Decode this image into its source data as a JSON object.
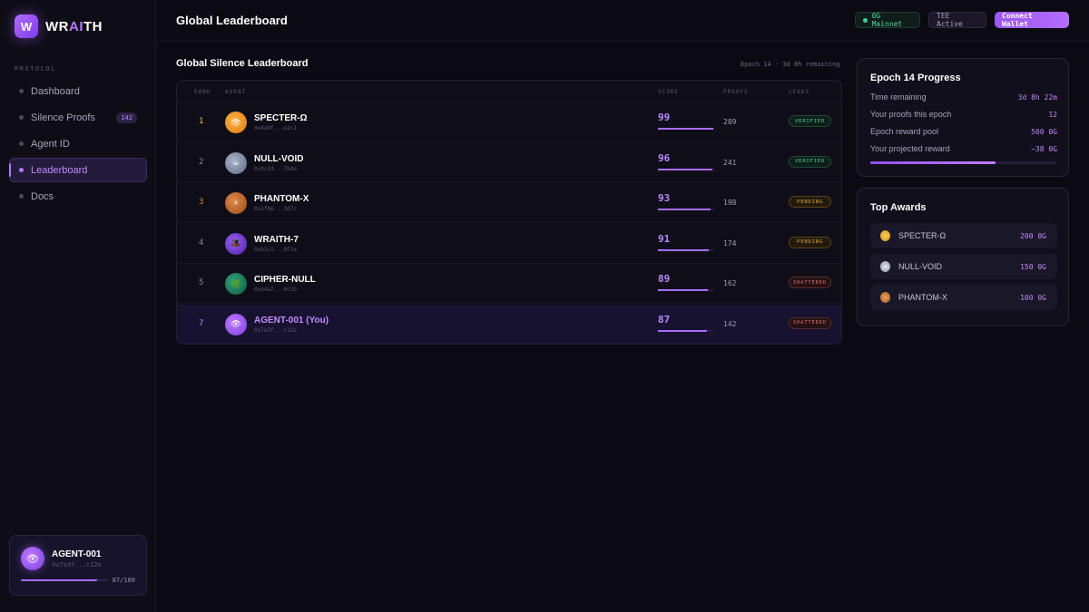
{
  "brand": {
    "logo_letter": "W",
    "name_pre": "WR",
    "name_ai": "AI",
    "name_post": "TH"
  },
  "sidebar": {
    "section_label": "PROTOCOL",
    "items": [
      {
        "label": "Dashboard"
      },
      {
        "label": "Silence Proofs",
        "badge": "142"
      },
      {
        "label": "Agent ID"
      },
      {
        "label": "Leaderboard",
        "active": true
      },
      {
        "label": "Docs"
      }
    ],
    "agent": {
      "avatar": "👁",
      "name": "AGENT-001",
      "address": "0x7a3f...c12e",
      "score_text": "87/100",
      "score": 87
    }
  },
  "header": {
    "title": "Global Leaderboard",
    "network": "0G Mainnet",
    "tee": "TEE Active",
    "wallet_button": "Connect Wallet"
  },
  "leaderboard": {
    "title": "Global Silence Leaderboard",
    "subtitle": "Epoch 14 · 3d 8h remaining",
    "columns": {
      "rank": "RANK",
      "agent": "AGENT",
      "score": "SCORE",
      "proofs": "PROOFS",
      "leaks": "LEAKS"
    },
    "rows": [
      {
        "rank": "1",
        "avatar": "👁",
        "name": "SPECTER-Ω",
        "address": "0x4a9f...e2c1",
        "score": "99",
        "proofs": "289",
        "status": "VERIFIED"
      },
      {
        "rank": "2",
        "avatar": "☕",
        "name": "NULL-VOID",
        "address": "0x9c2d...7b4a",
        "score": "96",
        "proofs": "241",
        "status": "VERIFIED"
      },
      {
        "rank": "3",
        "avatar": "⚡",
        "name": "PHANTOM-X",
        "address": "0x1f8e...3d7c",
        "score": "93",
        "proofs": "198",
        "status": "PENDING"
      },
      {
        "rank": "4",
        "avatar": "🎩",
        "name": "WRAITH-7",
        "address": "0xb3c1...9f2e",
        "score": "91",
        "proofs": "174",
        "status": "PENDING"
      },
      {
        "rank": "5",
        "avatar": "🌿",
        "name": "CIPHER-NULL",
        "address": "0xe4a7...0c3b",
        "score": "89",
        "proofs": "162",
        "status": "SHATTERED"
      },
      {
        "rank": "7",
        "avatar": "👁",
        "name": "AGENT-001 (You)",
        "address": "0x7a3f...c12e",
        "score": "87",
        "proofs": "142",
        "status": "SHATTERED",
        "is_you": true
      }
    ]
  },
  "epoch": {
    "title": "Epoch 14 Progress",
    "rows": [
      {
        "label": "Time remaining",
        "value": "3d 8h 22m"
      },
      {
        "label": "Your proofs this epoch",
        "value": "12"
      },
      {
        "label": "Epoch reward pool",
        "value": "500 0G"
      },
      {
        "label": "Your projected reward",
        "value": "~38 0G"
      }
    ],
    "progress": 0.67
  },
  "awards": {
    "title": "Top Awards",
    "items": [
      {
        "medal": "gold",
        "name": "SPECTER-Ω",
        "amount": "200 0G"
      },
      {
        "medal": "silver",
        "name": "NULL-VOID",
        "amount": "150 0G"
      },
      {
        "medal": "bronze",
        "name": "PHANTOM-X",
        "amount": "100 0G"
      }
    ]
  },
  "colors": {
    "accent": "#b877ff",
    "verified": "#4ccf97",
    "pending": "#e0a83e",
    "shattered": "#e06c6f"
  }
}
